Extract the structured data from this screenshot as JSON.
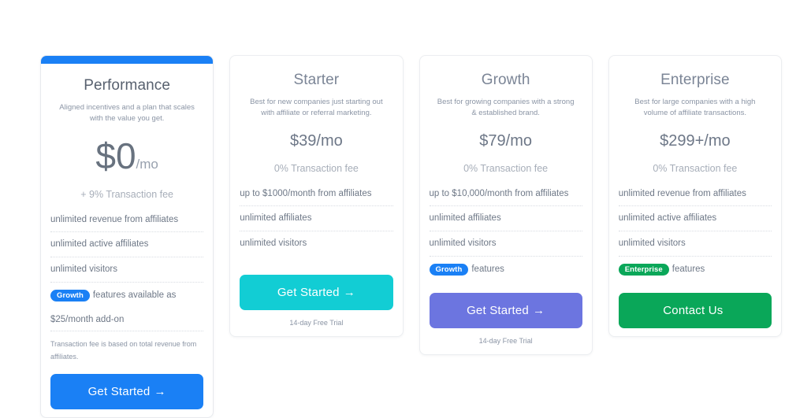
{
  "colors": {
    "blue": "#1a80f5",
    "teal": "#12cdd4",
    "purple": "#6c75e0",
    "green": "#0aa759",
    "text_muted": "#8b95a5",
    "text_body": "#6e7887"
  },
  "plans": [
    {
      "name": "Performance",
      "description": "Aligned incentives and a plan that scales with the value you get.",
      "price": "$0",
      "price_suffix": "/mo",
      "fee": "+ 9% Transaction fee",
      "features": [
        "unlimited revenue from affiliates",
        "unlimited active affiliates",
        "unlimited visitors"
      ],
      "badge": "Growth",
      "badge_suffix": "features available as",
      "addon": "$25/month add-on",
      "note": "Transaction fee is based on total revenue from affiliates.",
      "cta": "Get Started",
      "cta_arrow": "→",
      "trial": ""
    },
    {
      "name": "Starter",
      "description": "Best for new companies just starting out with affiliate or referral marketing.",
      "price": "$39/mo",
      "price_suffix": "",
      "fee": "0% Transaction fee",
      "features": [
        "up to $1000/month from affiliates",
        "unlimited affiliates",
        "unlimited visitors"
      ],
      "badge": "",
      "badge_suffix": "",
      "addon": "",
      "note": "",
      "cta": "Get Started",
      "cta_arrow": "→",
      "trial": "14-day Free Trial"
    },
    {
      "name": "Growth",
      "description": "Best for growing companies with a strong & established brand.",
      "price": "$79/mo",
      "price_suffix": "",
      "fee": "0% Transaction fee",
      "features": [
        "up to $10,000/month from affiliates",
        "unlimited affiliates",
        "unlimited visitors"
      ],
      "badge": "Growth",
      "badge_suffix": "features",
      "addon": "",
      "note": "",
      "cta": "Get Started",
      "cta_arrow": "→",
      "trial": "14-day Free Trial"
    },
    {
      "name": "Enterprise",
      "description": "Best for large companies with a high volume of affiliate transactions.",
      "price": "$299+/mo",
      "price_suffix": "",
      "fee": "0% Transaction fee",
      "features": [
        "unlimited revenue from affiliates",
        "unlimited active affiliates",
        "unlimited visitors"
      ],
      "badge": "Enterprise",
      "badge_suffix": "features",
      "addon": "",
      "note": "",
      "cta": "Contact Us",
      "cta_arrow": "",
      "trial": ""
    }
  ]
}
